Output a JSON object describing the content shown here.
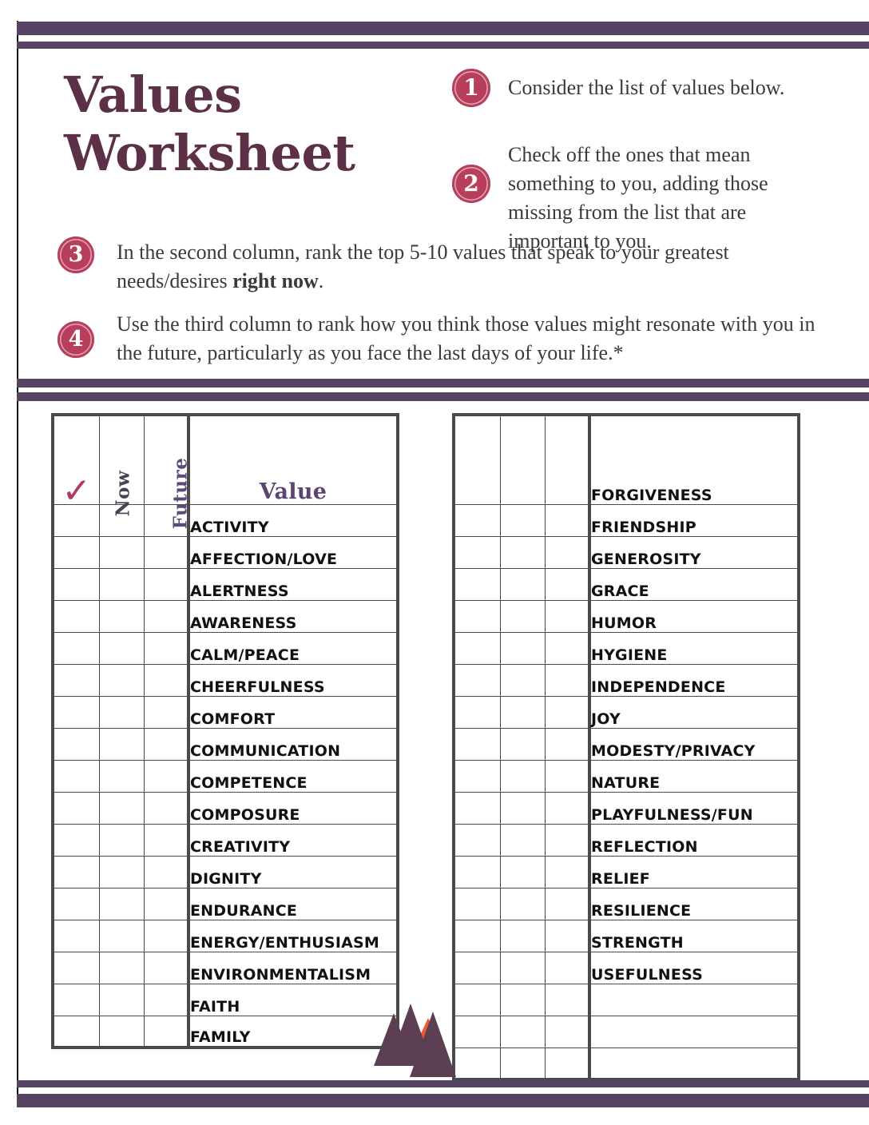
{
  "document": {
    "title_line_1": "Values",
    "title_line_2": "Worksheet"
  },
  "instructions": [
    {
      "number": "1",
      "text": "Consider the list of values below."
    },
    {
      "number": "2",
      "text": "Check off the ones that mean something to you, adding those missing from the list that are important to you."
    },
    {
      "number": "3",
      "text_before": "In the second column, rank the top 5-10 values that speak to your greatest needs/desires ",
      "emphasis": "right now",
      "text_after": "."
    },
    {
      "number": "4",
      "text": "Use the third column to rank how you think those values might resonate with you in the future, particularly as you face the last days of your life.*"
    }
  ],
  "table": {
    "headers": {
      "check": "✓",
      "now": "Now",
      "future": "Future",
      "value": "Value"
    },
    "left_values": [
      "ACTIVITY",
      "AFFECTION/LOVE",
      "ALERTNESS",
      "AWARENESS",
      "CALM/PEACE",
      "CHEERFULNESS",
      "COMFORT",
      "COMMUNICATION",
      "COMPETENCE",
      "COMPOSURE",
      "CREATIVITY",
      "DIGNITY",
      "ENDURANCE",
      "ENERGY/ENTHUSIASM",
      "ENVIRONMENTALISM",
      "FAITH",
      "FAMILY"
    ],
    "right_values": [
      "FORGIVENESS",
      "FRIENDSHIP",
      "GENEROSITY",
      "GRACE",
      "HUMOR",
      "HYGIENE",
      "INDEPENDENCE",
      "JOY",
      "MODESTY/PRIVACY",
      "NATURE",
      "PLAYFULNESS/FUN",
      "REFLECTION",
      "RELIEF",
      "RESILIENCE",
      "STRENGTH",
      "USEFULNESS",
      "",
      "",
      ""
    ]
  },
  "colors": {
    "purple_bar": "#564364",
    "title_plum": "#5c3147",
    "badge_crimson": "#b83e5e",
    "badge_ring": "#e0a8b8",
    "check_crimson": "#b33b62",
    "header_purple": "#5a4472",
    "grid_gray": "#4a4a4a",
    "logo_plum": "#5c3f52",
    "logo_orange": "#ee5a36"
  },
  "logo": {
    "name": "mountain-logo"
  }
}
